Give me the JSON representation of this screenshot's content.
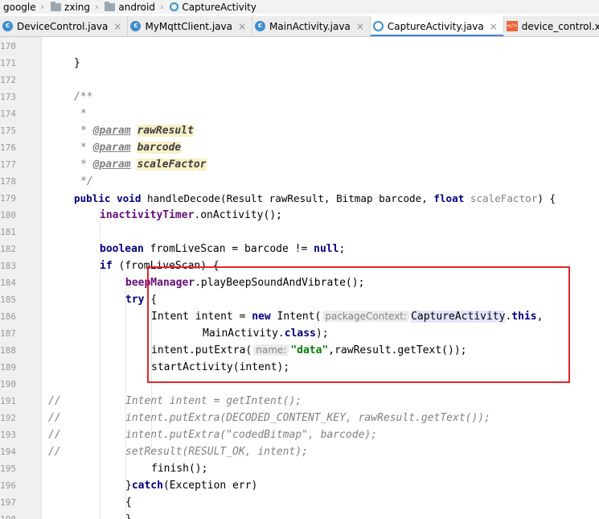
{
  "breadcrumb": [
    {
      "label": "google",
      "icon": "none"
    },
    {
      "label": "zxing",
      "icon": "folder-icon"
    },
    {
      "label": "android",
      "icon": "folder-icon"
    },
    {
      "label": "CaptureActivity",
      "icon": "class-icon"
    }
  ],
  "tabs": [
    {
      "label": "DeviceControl.java",
      "icon": "class-c-icon",
      "close": "×",
      "active": false
    },
    {
      "label": "MyMqttClient.java",
      "icon": "class-c-icon",
      "close": "×",
      "active": false
    },
    {
      "label": "MainActivity.java",
      "icon": "class-c-icon",
      "close": "×",
      "active": false
    },
    {
      "label": "CaptureActivity.java",
      "icon": "class-ring-icon",
      "close": "×",
      "active": true
    },
    {
      "label": "device_control.xml",
      "icon": "xml-icon",
      "close": "",
      "active": false
    }
  ],
  "xml_icon_text": "</>",
  "line_numbers": [
    "170",
    "171",
    "172",
    "173",
    "174",
    "175",
    "176",
    "177",
    "178",
    "179",
    "180",
    "181",
    "182",
    "183",
    "184",
    "185",
    "186",
    "187",
    "188",
    "189",
    "190",
    "191",
    "192",
    "193",
    "194",
    "195",
    "196",
    "197",
    "198"
  ],
  "code": {
    "l170": {
      "t1": "}"
    },
    "l172": {
      "t1": "/**"
    },
    "l173": {
      "t1": "*"
    },
    "l174": {
      "t1": "* ",
      "tag": "@param",
      "t2": " ",
      "p": "rawResult"
    },
    "l175": {
      "t1": "* ",
      "tag": "@param",
      "t2": " ",
      "p": "barcode"
    },
    "l176": {
      "t1": "* ",
      "tag": "@param",
      "t2": " ",
      "p": "scaleFactor"
    },
    "l177": {
      "t1": "*/"
    },
    "l178": {
      "k1": "public",
      "k2": "void",
      "t1": " handleDecode(Result rawResult, Bitmap barcode, ",
      "k3": "float",
      "u1": " scaleFactor",
      "t2": ") {"
    },
    "l179": {
      "f1": "inactivityTimer",
      "t1": ".onActivity();"
    },
    "l181": {
      "k1": "boolean",
      "t1": " fromLiveScan = barcode != ",
      "k2": "null",
      "t2": ";"
    },
    "l182": {
      "k1": "if",
      "t1": " (fromLiveScan) {"
    },
    "l183": {
      "f1": "beepManager",
      "t1": ".playBeepSoundAndVibrate();"
    },
    "l184": {
      "k1": "try",
      "t1": " {"
    },
    "l185": {
      "t1": "Intent intent = ",
      "k1": "new",
      "t2": " Intent(",
      "h1": "packageContext:",
      "hl1": "CaptureActivity",
      "t3": ".",
      "k2": "this",
      "t4": ","
    },
    "l186": {
      "t1": "MainActivity.",
      "k1": "class",
      "t2": ");"
    },
    "l187": {
      "t1": "intent.putExtra(",
      "h1": "name:",
      "s1": "\"data\"",
      "t2": ",rawResult.getText());"
    },
    "l188": {
      "t1": "startActivity(intent);"
    },
    "l190": {
      "c1": "//",
      "c2": "Intent intent = getIntent();"
    },
    "l191": {
      "c1": "//",
      "c2": "intent.putExtra(DECODED_CONTENT_KEY, rawResult.getText());"
    },
    "l192": {
      "c1": "//",
      "c2": "intent.putExtra(\"codedBitmap\", barcode);"
    },
    "l193": {
      "c1": "//",
      "c2": "setResult(RESULT_OK, intent);"
    },
    "l194": {
      "t1": "finish();"
    },
    "l195": {
      "t1": "}",
      "k1": "catch",
      "t2": "(Exception err)"
    },
    "l196": {
      "t1": "{"
    },
    "l197": {
      "t1": "}"
    }
  }
}
